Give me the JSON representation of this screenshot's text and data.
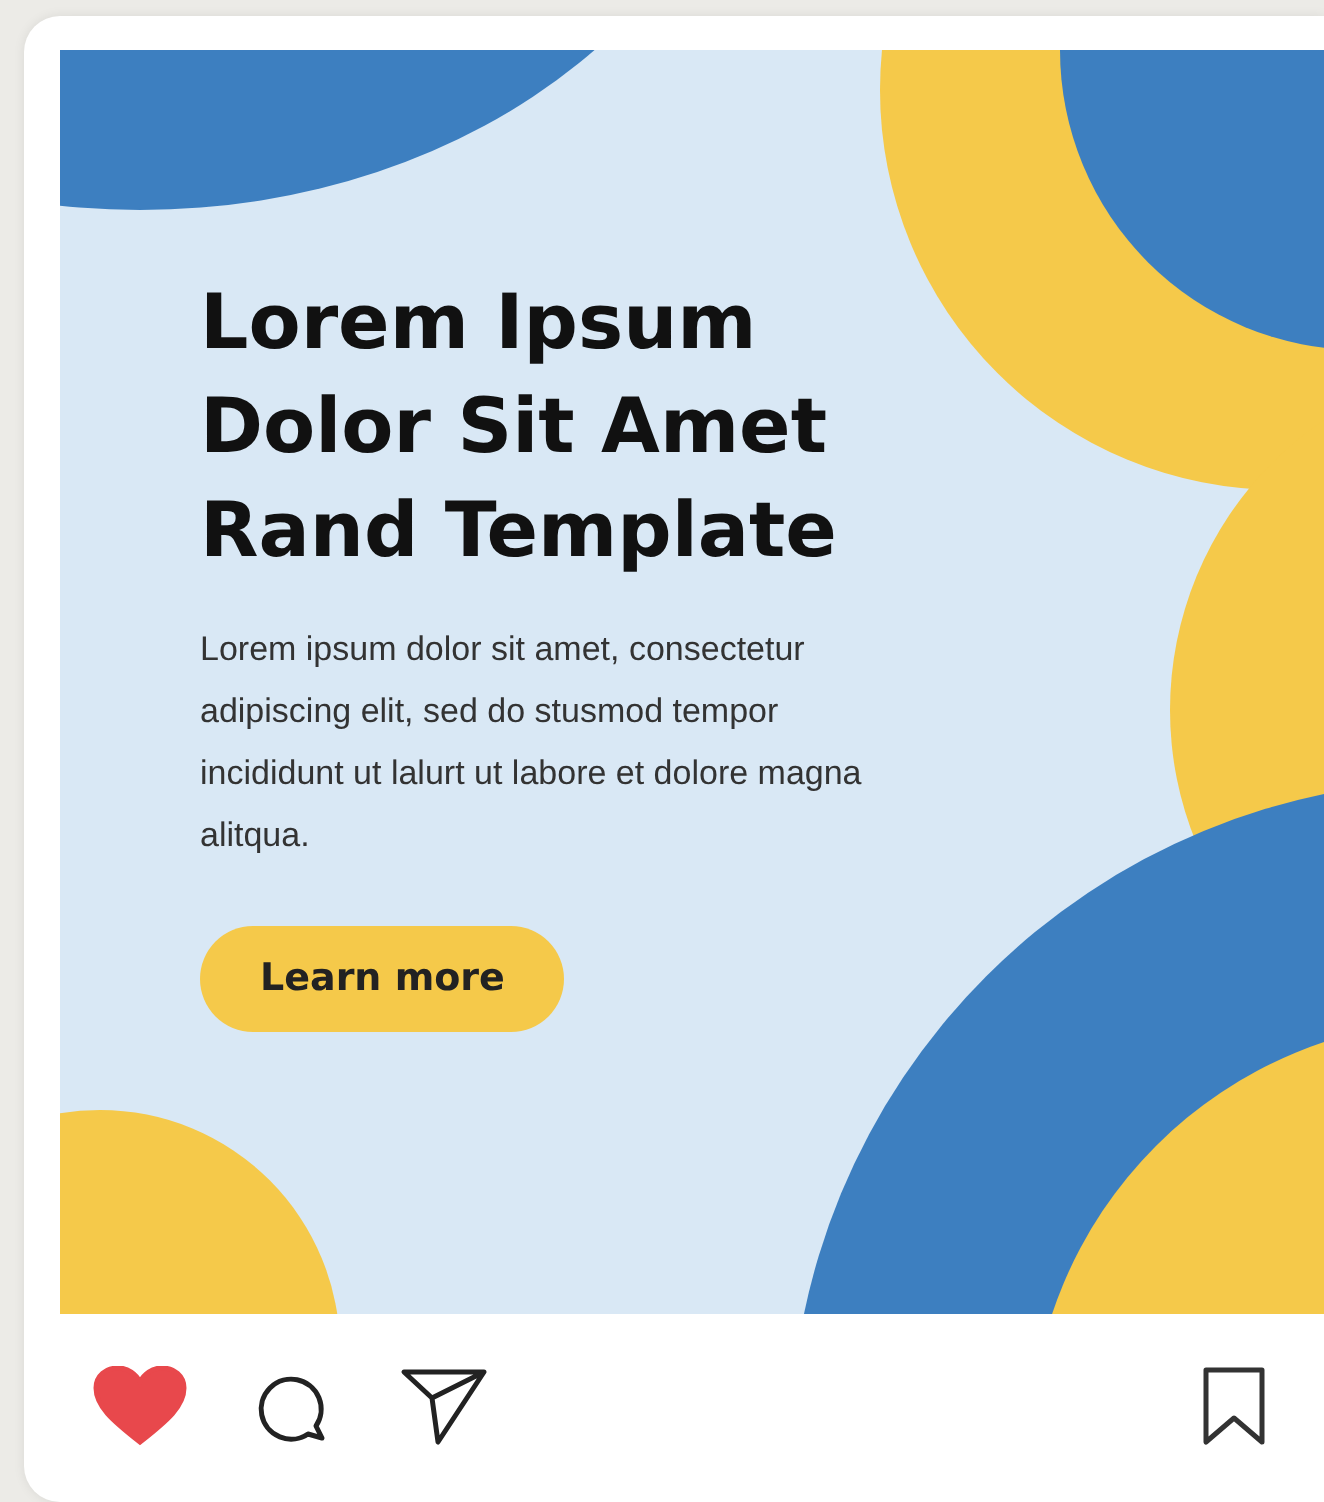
{
  "post": {
    "image": {
      "title_lines": [
        "Lorem Ipsum",
        "Dolor Sit Amet",
        "Rand Template"
      ],
      "body": "Lorem ipsum dolor sit amet, consectetur adipiscing elit, sed do stusmod tempor incididunt ut lalurt ut labore et dolore magna alitqua.",
      "button": "Learn more"
    },
    "actions": {
      "liked": true
    }
  }
}
